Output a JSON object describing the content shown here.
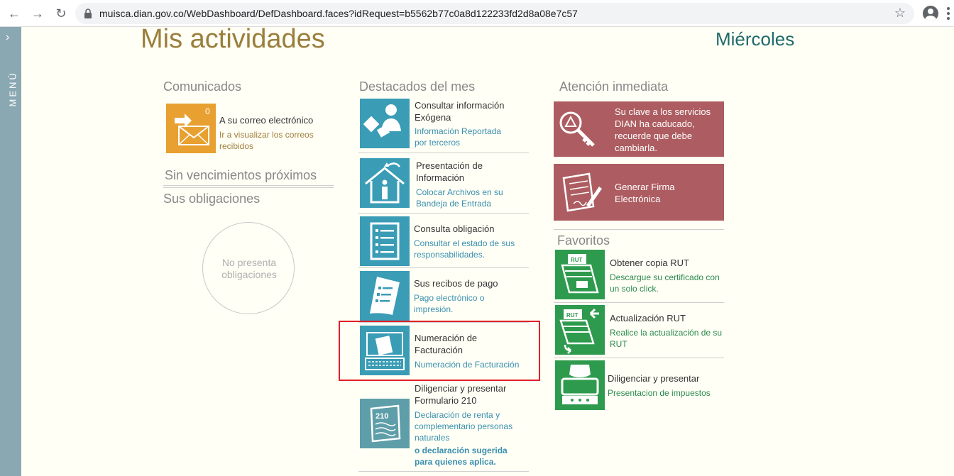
{
  "browser": {
    "url": "muisca.dian.gov.co/WebDashboard/DefDashboard.faces?idRequest=b5562b77c0a8d122233fd2d8a08e7c57"
  },
  "sidebar": {
    "label": "MENÚ"
  },
  "header": {
    "title": "Mis actividades",
    "day": "Miércoles"
  },
  "comunicados": {
    "title": "Comunicados",
    "mail_count": "0",
    "mail_title": "A su correo electrónico",
    "mail_desc_1": "Ir a visualizar los correos",
    "mail_desc_2": "recibidos",
    "sin_vencimientos": "Sin vencimientos próximos",
    "obligaciones_title": "Sus obligaciones",
    "no_obligaciones_1": "No presenta",
    "no_obligaciones_2": "obligaciones"
  },
  "destacados": {
    "title": "Destacados del mes",
    "items": [
      {
        "title_1": "Consultar información",
        "title_2": "Exógena",
        "sub_1": "Información Reportada",
        "sub_2": "por terceros"
      },
      {
        "title_1": "Presentación de",
        "title_2": "Información",
        "sub_1": "Colocar Archivos en su",
        "sub_2": "Bandeja de Entrada"
      },
      {
        "title_1": "Consulta obligación",
        "sub_1": "Consultar el estado de sus",
        "sub_2": "responsabilidades."
      },
      {
        "title_1": "Sus recibos de pago",
        "sub_1": "Pago electrónico o",
        "sub_2": "impresión."
      },
      {
        "title_1": "Numeración de",
        "title_2": "Facturación",
        "sub_1": "Numeración de Facturación"
      },
      {
        "title_1": "Diligenciar y presentar",
        "title_2": "Formulario 210",
        "sub_1": "Declaración de renta y",
        "sub_2": "complementario personas",
        "sub_3": "naturales",
        "bold_1": "o declaración sugerida",
        "bold_2": "para quienes aplica."
      }
    ]
  },
  "atencion": {
    "title": "Atención inmediata",
    "card1_lines": [
      "Su clave a los servicios",
      "DIAN ha caducado,",
      "recuerde que debe",
      "cambiarla."
    ],
    "card2_lines": [
      "Generar Firma",
      "Electrónica"
    ]
  },
  "favoritos": {
    "title": "Favoritos",
    "items": [
      {
        "title_1": "Obtener copia RUT",
        "sub_1": "Descargue su certificado con",
        "sub_2": "un solo click."
      },
      {
        "title_1": "Actualización RUT",
        "sub_1": "Realice la actualización de su",
        "sub_2": "RUT"
      },
      {
        "title_1": "Diligenciar y presentar",
        "sub_1": "Presentacion de impuestos"
      }
    ]
  },
  "icons": {
    "back": "arrow-left-icon",
    "forward": "arrow-right-icon",
    "reload": "reload-icon",
    "lock": "lock-icon",
    "star": "star-icon",
    "profile": "account-icon"
  },
  "colors": {
    "title_gold": "#9a7f3c",
    "day_teal": "#1f6b6b",
    "tile_blue": "#3a9cb5",
    "tile_green": "#2e9a4e",
    "tile_orange": "#e8a030",
    "card_red": "#ad5d61",
    "menu_bar": "#8aa8b2",
    "highlight_red": "#e0202a"
  }
}
